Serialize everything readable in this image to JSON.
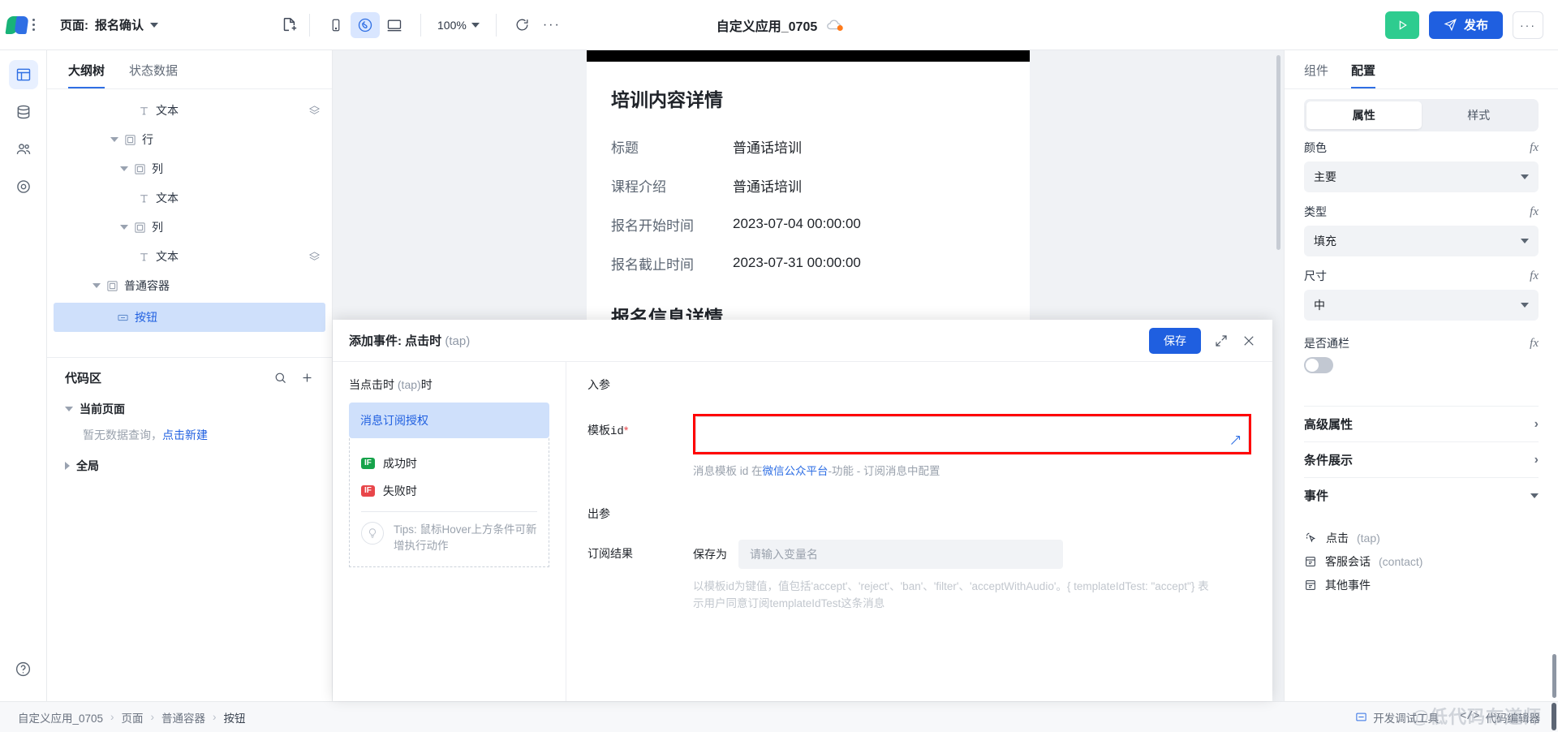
{
  "topbar": {
    "page_prefix": "页面:",
    "page_name": "报名确认",
    "new_page_icon": "new-document-icon",
    "device_mobile_icon": "mobile-device-icon",
    "device_weapp_icon": "mini-program-icon",
    "device_desktop_icon": "desktop-device-icon",
    "zoom": "100%",
    "refresh_icon": "refresh-icon",
    "more_icon": "ellipsis-icon",
    "app_title": "自定义应用_0705",
    "cloud_icon": "cloud-unsynced-icon",
    "run_icon": "play-icon",
    "publish_label": "发布",
    "publish_icon": "send-icon",
    "overflow_label": "···"
  },
  "rail": {
    "items": [
      {
        "name": "pages-icon",
        "active": true
      },
      {
        "name": "database-icon",
        "active": false
      },
      {
        "name": "users-icon",
        "active": false
      },
      {
        "name": "settings-target-icon",
        "active": false
      }
    ],
    "help_icon": "help-circle-icon"
  },
  "left_panel": {
    "tabs": [
      {
        "label": "大纲树",
        "active": true
      },
      {
        "label": "状态数据",
        "active": false
      }
    ],
    "tree": [
      {
        "label": "文本",
        "icon": "text-icon",
        "indent": 4,
        "caret": "none",
        "layers": true,
        "selected": false
      },
      {
        "label": "行",
        "icon": "container-icon",
        "indent": 3,
        "caret": "down",
        "layers": false,
        "selected": false
      },
      {
        "label": "列",
        "icon": "container-icon",
        "indent": 4,
        "caret": "down",
        "layers": false,
        "selected": false
      },
      {
        "label": "文本",
        "icon": "text-icon",
        "indent": 5,
        "caret": "none",
        "layers": false,
        "selected": false
      },
      {
        "label": "列",
        "icon": "container-icon",
        "indent": 4,
        "caret": "down",
        "layers": false,
        "selected": false
      },
      {
        "label": "文本",
        "icon": "text-icon",
        "indent": 5,
        "caret": "none",
        "layers": true,
        "selected": false
      },
      {
        "label": "普通容器",
        "icon": "container-icon",
        "indent": 2,
        "caret": "down",
        "layers": false,
        "selected": false
      },
      {
        "label": "按钮",
        "icon": "button-icon",
        "indent": 3,
        "caret": "none",
        "layers": false,
        "selected": true
      }
    ],
    "code_area": {
      "title": "代码区",
      "search_icon": "search-icon",
      "add_icon": "plus-icon",
      "current_page_label": "当前页面",
      "empty_text": "暂无数据查询，",
      "empty_link": "点击新建",
      "global_label": "全局"
    }
  },
  "canvas": {
    "detail_title": "培训内容详情",
    "rows": [
      {
        "key": "标题",
        "value": "普通话培训"
      },
      {
        "key": "课程介绍",
        "value": "普通话培训"
      },
      {
        "key": "报名开始时间",
        "value": "2023-07-04 00:00:00"
      },
      {
        "key": "报名截止时间",
        "value": "2023-07-31 00:00:00"
      }
    ],
    "signup_title": "报名信息详情"
  },
  "modal": {
    "title_prefix": "添加事件:",
    "title_event": "点击时",
    "title_tap": "(tap)",
    "save_label": "保存",
    "expand_icon": "expand-icon",
    "close_icon": "close-icon",
    "left": {
      "when_prefix": "当",
      "when_event": "点击时",
      "when_tap": "(tap)",
      "when_suffix": "时",
      "action_chip": "消息订阅授权",
      "branches": [
        {
          "tag": "IF",
          "label": "成功时",
          "type": "success"
        },
        {
          "tag": "IF",
          "label": "失败时",
          "type": "fail"
        }
      ],
      "tips_icon": "lightbulb-icon",
      "tips_text": "Tips: 鼠标Hover上方条件可新增执行动作"
    },
    "right": {
      "in_params_label": "入参",
      "template_id_label": "模板id",
      "template_id_required": "*",
      "template_id_value": "",
      "template_id_fx_icon": "formula-corner-icon",
      "hint_before": "消息模板 id 在",
      "hint_link": "微信公众平台",
      "hint_after": "-功能 - 订阅消息中配置",
      "out_params_label": "出参",
      "result_label": "订阅结果",
      "save_as_label": "保存为",
      "save_as_placeholder": "请输入变量名",
      "result_hint": "以模板id为键值，值包括'accept'、'reject'、'ban'、'filter'、'acceptWithAudio'。{ templateIdTest: \"accept\"} 表示用户同意订阅templateIdTest这条消息"
    }
  },
  "right_panel": {
    "tabs": [
      {
        "label": "组件",
        "active": false
      },
      {
        "label": "配置",
        "active": true
      }
    ],
    "segments": [
      {
        "label": "属性",
        "active": true
      },
      {
        "label": "样式",
        "active": false
      }
    ],
    "fields": [
      {
        "label": "颜色",
        "value": "主要",
        "fx": "fx"
      },
      {
        "label": "类型",
        "value": "填充",
        "fx": "fx"
      },
      {
        "label": "尺寸",
        "value": "中",
        "fx": "fx"
      }
    ],
    "toggle_field": {
      "label": "是否通栏",
      "fx": "fx",
      "on": false
    },
    "accordions": [
      {
        "label": "高级属性",
        "state": "collapsed"
      },
      {
        "label": "条件展示",
        "state": "collapsed"
      },
      {
        "label": "事件",
        "state": "expanded"
      }
    ],
    "events": [
      {
        "icon": "cursor-click-icon",
        "label": "点击",
        "code": "(tap)"
      },
      {
        "icon": "calendar-icon",
        "label": "客服会话",
        "code": "(contact)"
      },
      {
        "icon": "calendar-icon",
        "label": "其他事件",
        "code": ""
      }
    ]
  },
  "statusbar": {
    "breadcrumb": [
      "自定义应用_0705",
      "页面",
      "普通容器",
      "按钮"
    ],
    "separator": "›",
    "devtools_label": "开发调试工具",
    "devtools_icon": "window-icon",
    "code_editor_label": "代码编辑器",
    "code_editor_icon": "code-tag-icon",
    "watermark": "@低代码布道师"
  }
}
